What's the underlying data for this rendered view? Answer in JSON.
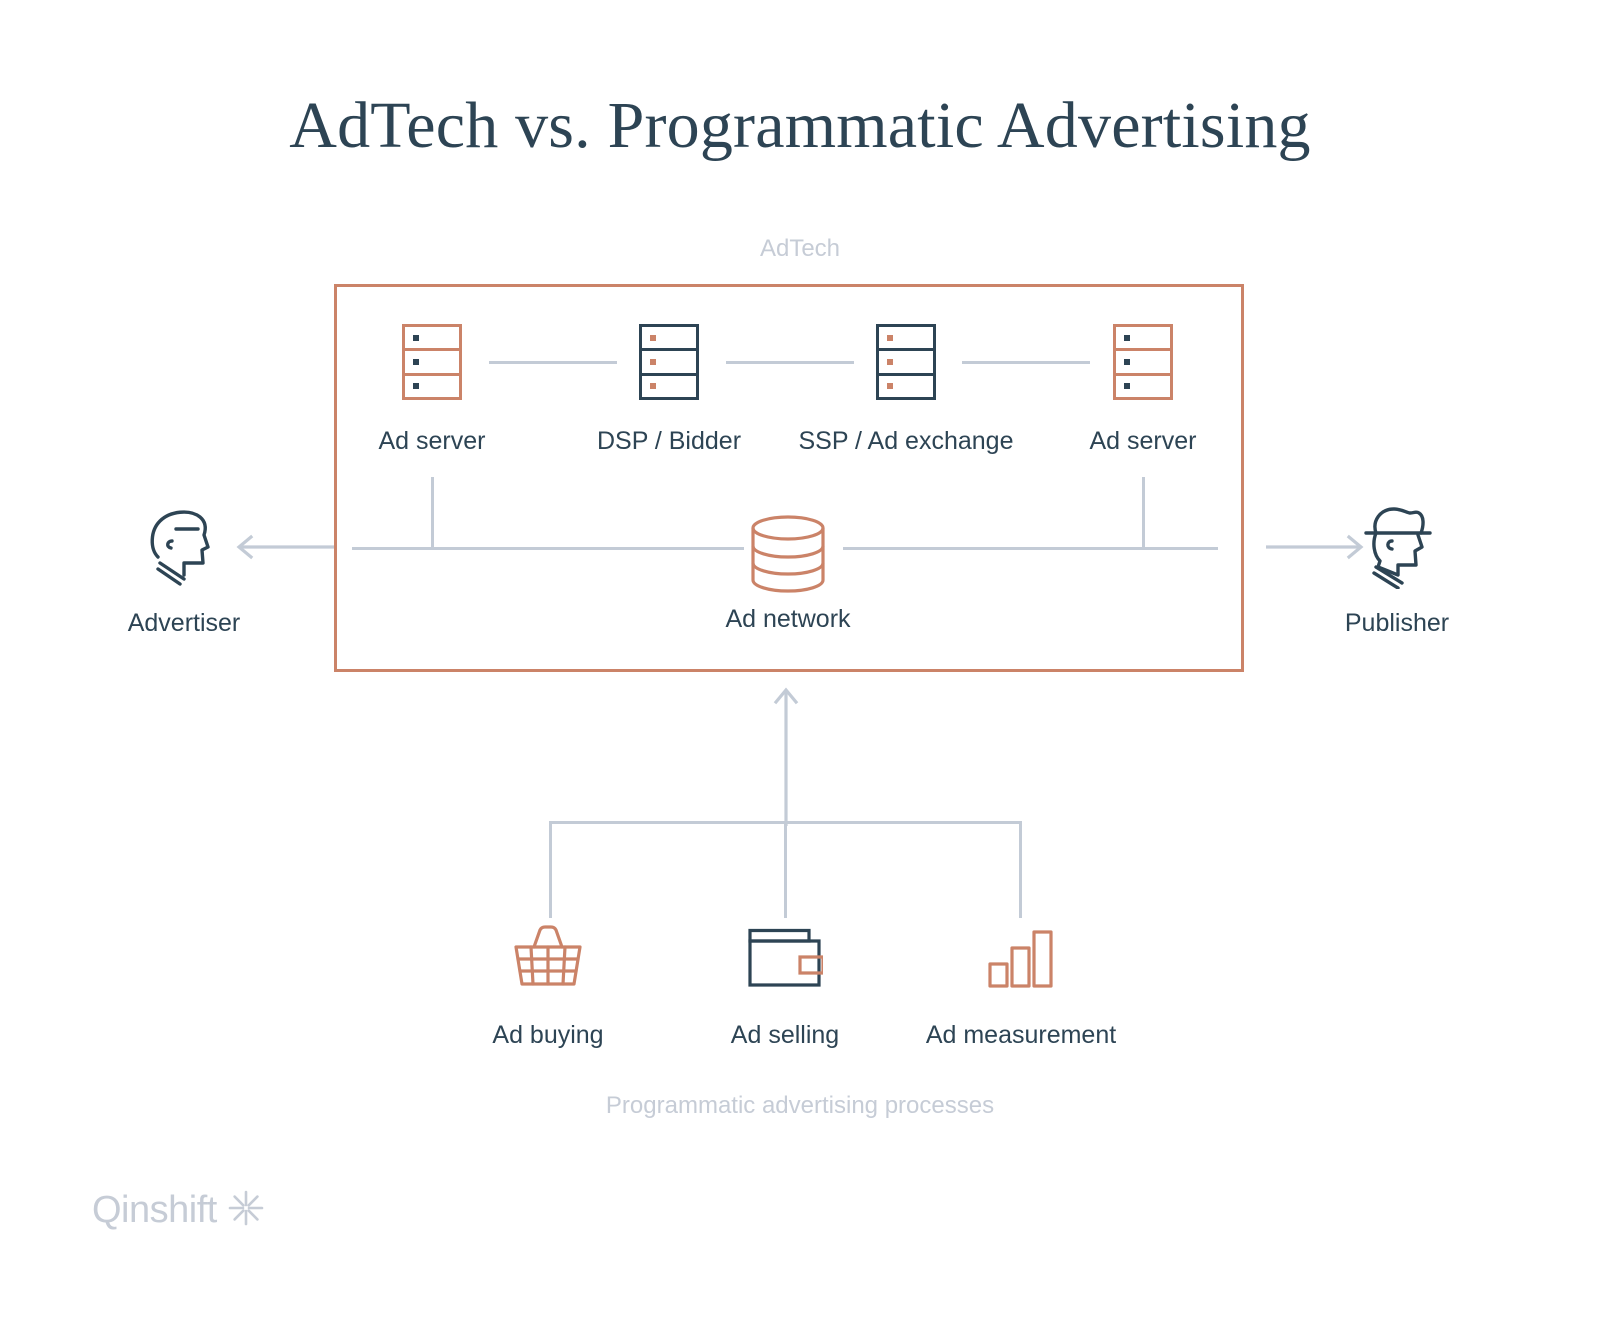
{
  "page": {
    "title": "AdTech vs. Programmatic Advertising",
    "background_color": "#ffffff"
  },
  "colors": {
    "terracotta": "#cb8368",
    "navy": "#2d4454",
    "light_gray_blue": "#c3cbd6",
    "caption_gray": "#c6ccd6"
  },
  "adtech": {
    "caption": "AdTech",
    "nodes": [
      {
        "label": "Ad server",
        "icon": "server-icon",
        "style": "terracotta"
      },
      {
        "label": "DSP / Bidder",
        "icon": "server-icon",
        "style": "navy"
      },
      {
        "label": "SSP / Ad exchange",
        "icon": "server-icon",
        "style": "navy"
      },
      {
        "label": "Ad server",
        "icon": "server-icon",
        "style": "terracotta"
      }
    ],
    "center": {
      "label": "Ad network",
      "icon": "database-icon"
    }
  },
  "actors": {
    "left": {
      "label": "Advertiser",
      "icon": "head-profile-icon",
      "arrow": "arrow-left-icon"
    },
    "right": {
      "label": "Publisher",
      "icon": "head-with-hat-icon",
      "arrow": "arrow-right-icon"
    }
  },
  "programmatic": {
    "caption": "Programmatic advertising processes",
    "arrow": "arrow-up-icon",
    "items": [
      {
        "label": "Ad buying",
        "icon": "shopping-basket-icon"
      },
      {
        "label": "Ad selling",
        "icon": "wallet-icon"
      },
      {
        "label": "Ad measurement",
        "icon": "bar-chart-icon"
      }
    ]
  },
  "brand": {
    "name": "Qinshift",
    "mark": "starburst-icon"
  }
}
